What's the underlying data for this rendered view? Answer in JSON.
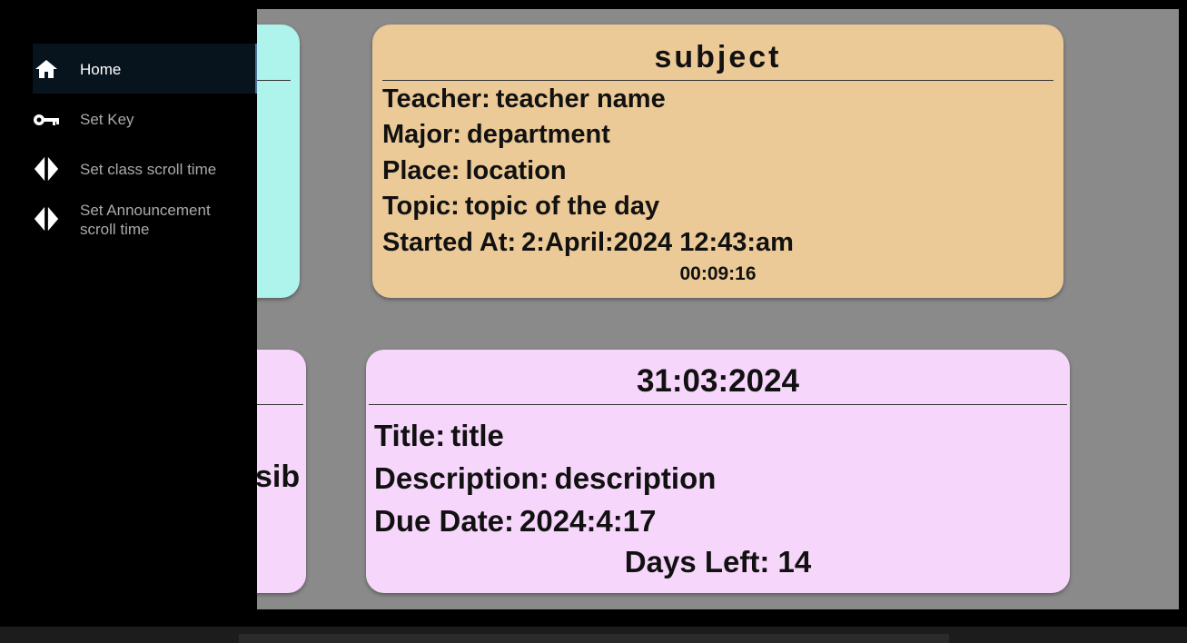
{
  "drawer": {
    "items": [
      {
        "label": "Home",
        "icon": "home-icon",
        "active": true
      },
      {
        "label": "Set Key",
        "icon": "key-icon",
        "active": false
      },
      {
        "label": "Set class scroll time",
        "icon": "scroll-arrows-icon",
        "active": false
      },
      {
        "label": "Set Announcement scroll time",
        "icon": "scroll-arrows-icon",
        "active": false
      }
    ]
  },
  "class_card": {
    "subject": "subject",
    "teacher_label": "Teacher:",
    "teacher": "teacher name",
    "major_label": "Major:",
    "major": "department",
    "place_label": "Place:",
    "place": "location",
    "topic_label": "Topic:",
    "topic": "topic of the day",
    "started_label": "Started At:",
    "started": "2:April:2024 12:43:am",
    "elapsed": "00:09:16"
  },
  "announcement_card": {
    "date": "31:03:2024",
    "title_label": "Title:",
    "title": "title",
    "description_label": "Description:",
    "description": "description",
    "due_label": "Due Date:",
    "due": "2024:4:17",
    "days_left_label": "Days Left:",
    "days_left": "14"
  },
  "peek_announcement_fragment": "sib",
  "colors": {
    "class_card": "#ebca97",
    "class_card_left": "#aef3ec",
    "announcement_card": "#f7d6fb",
    "background": "#8a8a8a",
    "drawer": "#000000"
  }
}
